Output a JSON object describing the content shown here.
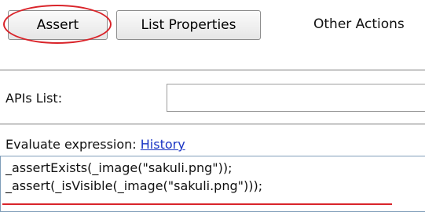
{
  "toolbar": {
    "assert_label": "Assert",
    "list_properties_label": "List Properties",
    "other_actions_label": "Other Actions"
  },
  "apis": {
    "label": "APIs List:",
    "value": ""
  },
  "evaluate": {
    "label": "Evaluate expression:",
    "history_link": "History",
    "code_lines": [
      "_assertExists(_image(\"sakuli.png\"));",
      "_assert(_isVisible(_image(\"sakuli.png\")));"
    ]
  },
  "colors": {
    "annotation": "#d9242a",
    "link": "#1a34c4"
  }
}
